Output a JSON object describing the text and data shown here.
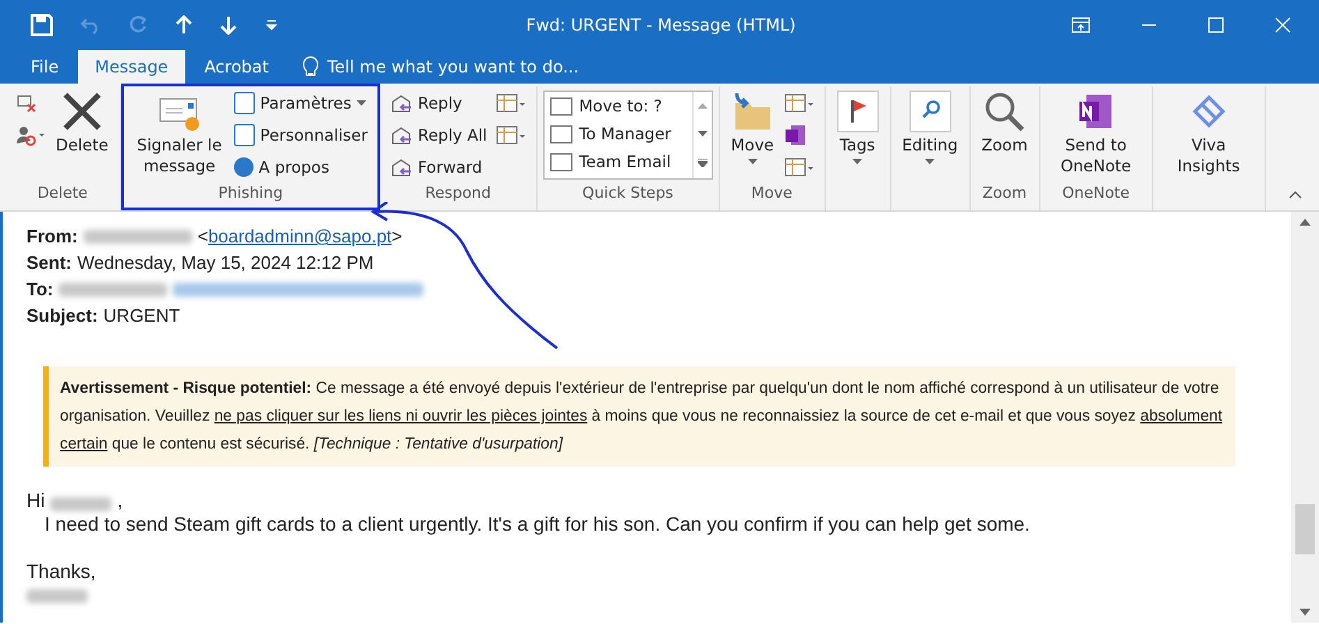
{
  "window": {
    "title": "Fwd: URGENT - Message (HTML)"
  },
  "tabs": [
    {
      "label": "File",
      "selected": false
    },
    {
      "label": "Message",
      "selected": true
    },
    {
      "label": "Acrobat",
      "selected": false
    }
  ],
  "tell_me": {
    "placeholder": "Tell me what you want to do..."
  },
  "ribbon": {
    "groups": [
      {
        "label": "Delete",
        "highlighted": false,
        "items": [
          {
            "kind": "ignore"
          },
          {
            "kind": "junk"
          },
          {
            "kind": "delete",
            "label": "Delete"
          }
        ]
      },
      {
        "label": "Phishing",
        "highlighted": true,
        "items": [
          {
            "kind": "report",
            "label": "Signaler le message"
          },
          {
            "kind": "settings",
            "label": "Paramètres"
          },
          {
            "kind": "personalize",
            "label": "Personnaliser"
          },
          {
            "kind": "about",
            "label": "A propos"
          }
        ]
      },
      {
        "label": "Respond",
        "highlighted": false,
        "items": [
          {
            "kind": "reply",
            "label": "Reply"
          },
          {
            "kind": "replyall",
            "label": "Reply All"
          },
          {
            "kind": "forward",
            "label": "Forward"
          },
          {
            "kind": "meeting"
          },
          {
            "kind": "more"
          }
        ]
      },
      {
        "label": "Quick Steps",
        "highlighted": false,
        "items": [
          {
            "kind": "quicksteps"
          }
        ],
        "quick_steps": [
          "Move to: ?",
          "To Manager",
          "Team Email"
        ]
      },
      {
        "label": "Move",
        "highlighted": false,
        "items": [
          {
            "kind": "move",
            "label": "Move"
          },
          {
            "kind": "rules"
          },
          {
            "kind": "onenote-small"
          },
          {
            "kind": "actions"
          }
        ]
      },
      {
        "highlighted": false,
        "items": [
          {
            "kind": "tags",
            "label": "Tags"
          }
        ]
      },
      {
        "highlighted": false,
        "items": [
          {
            "kind": "editing",
            "label": "Editing"
          }
        ]
      },
      {
        "label": "Zoom",
        "highlighted": false,
        "items": [
          {
            "kind": "zoom",
            "label": "Zoom"
          }
        ]
      },
      {
        "label": "OneNote",
        "highlighted": false,
        "items": [
          {
            "kind": "onenote",
            "label": "Send to OneNote"
          }
        ]
      },
      {
        "highlighted": false,
        "items": [
          {
            "kind": "viva",
            "label": "Viva Insights"
          }
        ]
      }
    ]
  },
  "headers": [
    {
      "label": "From:",
      "redacted": true,
      "link_open": "<",
      "link": "boardadminn@sapo.pt",
      "link_close": ">",
      "link_redacted": false
    },
    {
      "label": "Sent:",
      "value": "Wednesday, May 15, 2024 12:12 PM",
      "redacted": false,
      "link_redacted": false
    },
    {
      "label": "To:",
      "redacted": true,
      "link_redacted": true
    },
    {
      "label": "Subject:",
      "value": "URGENT",
      "redacted": false,
      "link_redacted": false
    }
  ],
  "warning": [
    {
      "kind": "bold",
      "text": "Avertissement - Risque potentiel:"
    },
    {
      "kind": "plain",
      "text": " Ce message a été envoyé depuis l'extérieur de l'entreprise par quelqu'un dont le nom affiché correspond à un utilisateur de votre organisation. Veuillez "
    },
    {
      "kind": "underline",
      "text": "ne pas cliquer sur les liens ni ouvrir les pièces jointes"
    },
    {
      "kind": "plain",
      "text": " à moins que vous ne reconnaissiez la source de cet e-mail et que vous soyez "
    },
    {
      "kind": "underline",
      "text": "absolument certain"
    },
    {
      "kind": "plain",
      "text": " que le contenu est sécurisé. "
    },
    {
      "kind": "italic",
      "text": "[Technique : Tentative d'usurpation]"
    }
  ],
  "body": {
    "greeting": "Hi",
    "greeting_end": ",",
    "text": "I need to send Steam gift cards to a client urgently. It's a gift for his son. Can you confirm if you can help get some.",
    "closing": "Thanks,"
  }
}
